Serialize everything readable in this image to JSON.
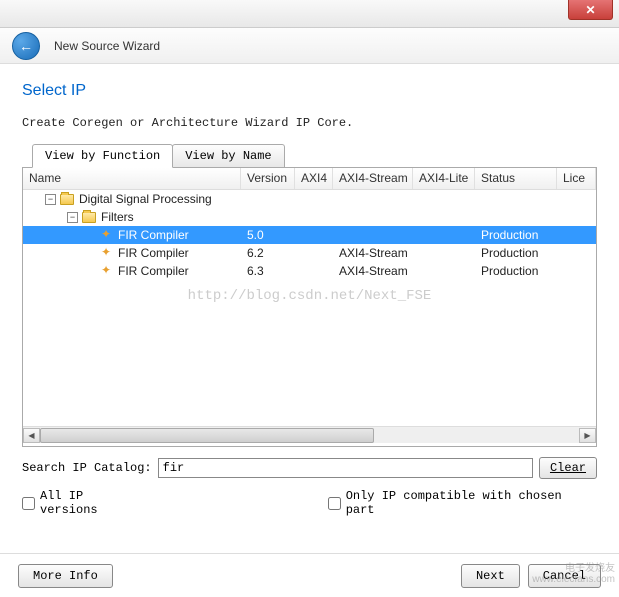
{
  "window": {
    "title": "New Source Wizard",
    "close_x": "✕"
  },
  "page": {
    "title": "Select IP",
    "subtitle": "Create Coregen or Architecture Wizard IP Core."
  },
  "tabs": [
    {
      "label": "View by Function",
      "active": true
    },
    {
      "label": "View by Name",
      "active": false
    }
  ],
  "columns": {
    "name": "Name",
    "version": "Version",
    "axi4": "AXI4",
    "axi4_stream": "AXI4-Stream",
    "axi4_lite": "AXI4-Lite",
    "status": "Status",
    "license": "Lice"
  },
  "tree": {
    "group1": "Digital Signal Processing",
    "group2": "Filters",
    "rows": [
      {
        "name": "FIR Compiler",
        "version": "5.0",
        "axi4": "",
        "axi4s": "",
        "axi4l": "",
        "status": "Production",
        "selected": true
      },
      {
        "name": "FIR Compiler",
        "version": "6.2",
        "axi4": "",
        "axi4s": "AXI4-Stream",
        "axi4l": "",
        "status": "Production",
        "selected": false
      },
      {
        "name": "FIR Compiler",
        "version": "6.3",
        "axi4": "",
        "axi4s": "AXI4-Stream",
        "axi4l": "",
        "status": "Production",
        "selected": false
      }
    ]
  },
  "watermark": "http://blog.csdn.net/Next_FSE",
  "search": {
    "label": "Search IP Catalog:",
    "value": "fir",
    "clear": "Clear"
  },
  "checkboxes": {
    "all_versions": "All IP versions",
    "only_compatible": "Only IP compatible with chosen part"
  },
  "footer": {
    "more_info": "More Info",
    "next": "Next",
    "cancel": "Cancel"
  },
  "corner_watermark": "电子发烧友 www.elecfans.com"
}
